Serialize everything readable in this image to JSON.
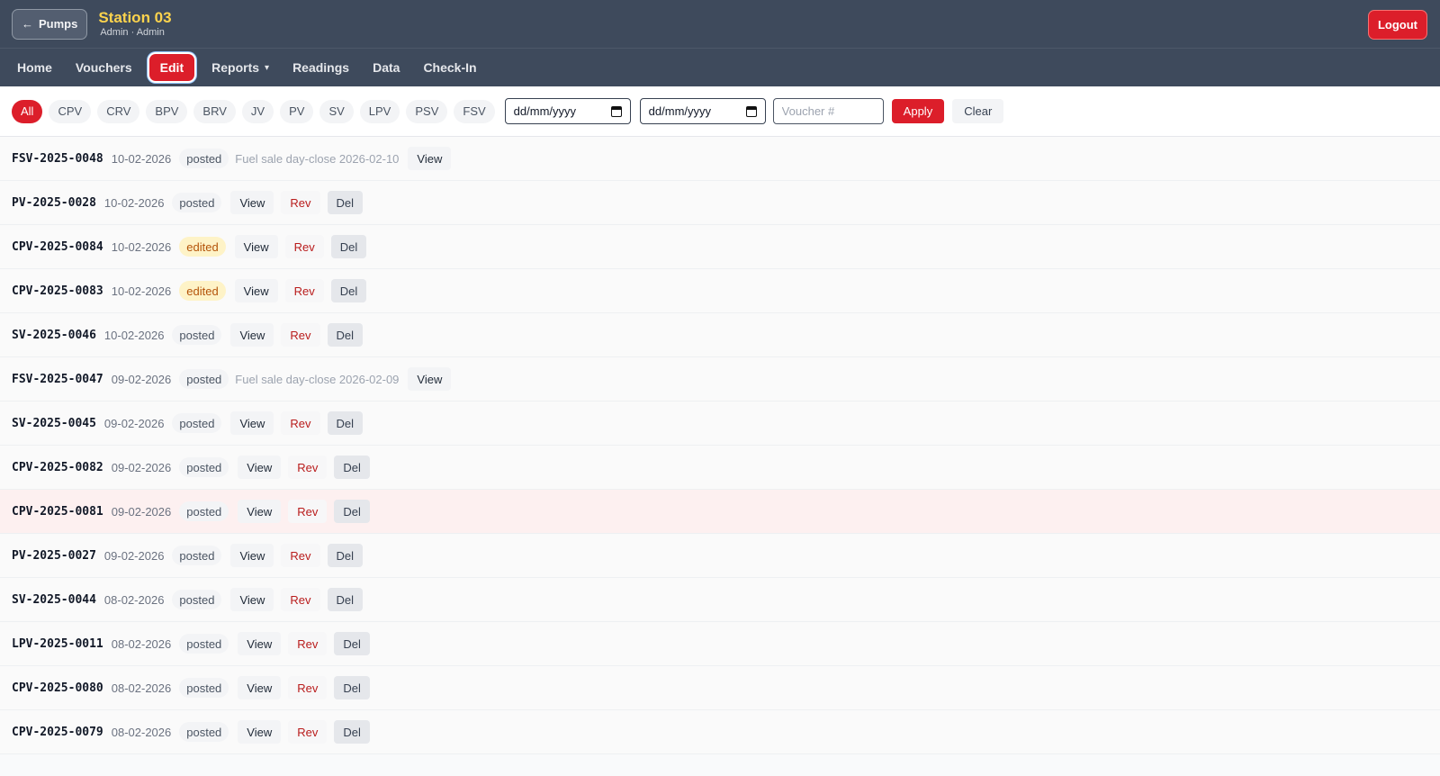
{
  "header": {
    "back_label": "Pumps",
    "title": "Station 03",
    "subtitle": "Admin · Admin",
    "logout_label": "Logout"
  },
  "nav": {
    "items": [
      "Home",
      "Vouchers",
      "Edit",
      "Reports",
      "Readings",
      "Data",
      "Check-In"
    ],
    "active": "Edit"
  },
  "filters": {
    "chips": [
      "All",
      "CPV",
      "CRV",
      "BPV",
      "BRV",
      "JV",
      "PV",
      "SV",
      "LPV",
      "PSV",
      "FSV"
    ],
    "active_chip": "All",
    "date_from_placeholder": "dd/mm/yyyy",
    "date_to_placeholder": "dd/mm/yyyy",
    "voucher_placeholder": "Voucher #",
    "apply_label": "Apply",
    "clear_label": "Clear"
  },
  "actions": {
    "view": "View",
    "rev": "Rev",
    "del": "Del"
  },
  "vouchers": [
    {
      "no": "FSV-2025-0048",
      "date": "10-02-2026",
      "status": "posted",
      "desc": "Fuel sale day-close 2026-02-10",
      "actions": [
        "view"
      ]
    },
    {
      "no": "PV-2025-0028",
      "date": "10-02-2026",
      "status": "posted",
      "desc": "",
      "actions": [
        "view",
        "rev",
        "del"
      ]
    },
    {
      "no": "CPV-2025-0084",
      "date": "10-02-2026",
      "status": "edited",
      "desc": "",
      "actions": [
        "view",
        "rev",
        "del"
      ]
    },
    {
      "no": "CPV-2025-0083",
      "date": "10-02-2026",
      "status": "edited",
      "desc": "",
      "actions": [
        "view",
        "rev",
        "del"
      ]
    },
    {
      "no": "SV-2025-0046",
      "date": "10-02-2026",
      "status": "posted",
      "desc": "",
      "actions": [
        "view",
        "rev",
        "del"
      ]
    },
    {
      "no": "FSV-2025-0047",
      "date": "09-02-2026",
      "status": "posted",
      "desc": "Fuel sale day-close 2026-02-09",
      "actions": [
        "view"
      ]
    },
    {
      "no": "SV-2025-0045",
      "date": "09-02-2026",
      "status": "posted",
      "desc": "",
      "actions": [
        "view",
        "rev",
        "del"
      ]
    },
    {
      "no": "CPV-2025-0082",
      "date": "09-02-2026",
      "status": "posted",
      "desc": "",
      "actions": [
        "view",
        "rev",
        "del"
      ]
    },
    {
      "no": "CPV-2025-0081",
      "date": "09-02-2026",
      "status": "posted",
      "desc": "",
      "actions": [
        "view",
        "rev",
        "del"
      ],
      "highlight": true
    },
    {
      "no": "PV-2025-0027",
      "date": "09-02-2026",
      "status": "posted",
      "desc": "",
      "actions": [
        "view",
        "rev",
        "del"
      ]
    },
    {
      "no": "SV-2025-0044",
      "date": "08-02-2026",
      "status": "posted",
      "desc": "",
      "actions": [
        "view",
        "rev",
        "del"
      ]
    },
    {
      "no": "LPV-2025-0011",
      "date": "08-02-2026",
      "status": "posted",
      "desc": "",
      "actions": [
        "view",
        "rev",
        "del"
      ]
    },
    {
      "no": "CPV-2025-0080",
      "date": "08-02-2026",
      "status": "posted",
      "desc": "",
      "actions": [
        "view",
        "rev",
        "del"
      ]
    },
    {
      "no": "CPV-2025-0079",
      "date": "08-02-2026",
      "status": "posted",
      "desc": "",
      "actions": [
        "view",
        "rev",
        "del"
      ]
    }
  ]
}
